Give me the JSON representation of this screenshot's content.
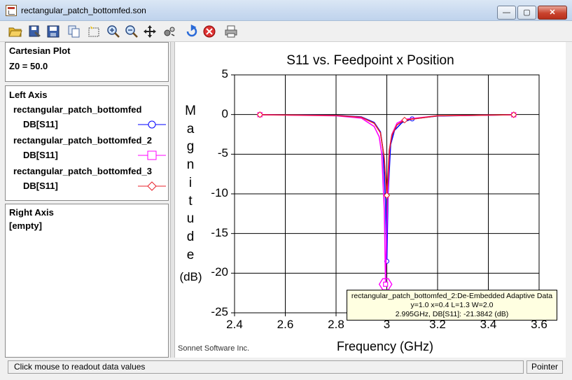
{
  "window": {
    "title": "rectangular_patch_bottomfed.son",
    "min": "—",
    "max": "▢",
    "close": "✕"
  },
  "toolbar": {
    "icons": [
      "open-folder-icon",
      "save-as-icon",
      "save-icon",
      "copy-icon",
      "select-icon",
      "zoom-in-icon",
      "zoom-out-icon",
      "pan-icon",
      "rotate-icon",
      "reload-icon",
      "cancel-icon",
      "print-icon"
    ]
  },
  "panel": {
    "plot_type": "Cartesian Plot",
    "z0": "Z0 = 50.0",
    "left_axis_title": "Left Axis",
    "right_axis_title": "Right Axis",
    "right_axis_value": "[empty]"
  },
  "credit": "Sonnet Software Inc.",
  "tooltip": {
    "line1": "rectangular_patch_bottomfed_2:De-Embedded Adaptive Data",
    "line2": "y=1.0 x=0.4 L=1.3 W=2.0",
    "line3": "2.995GHz, DB[S11]: -21.3842  (dB)"
  },
  "status": {
    "message": "Click mouse to readout data values",
    "mode": "Pointer"
  },
  "chart_data": {
    "type": "line",
    "title": "S11 vs. Feedpoint x Position",
    "xlabel": "Frequency (GHz)",
    "ylabel": "Magnitude",
    "yunit": "(dB)",
    "xlim": [
      2.4,
      3.6
    ],
    "ylim": [
      -25,
      5
    ],
    "xticks": [
      2.4,
      2.6,
      2.8,
      3.0,
      3.2,
      3.4,
      3.6
    ],
    "xtick_labels": [
      "2.4",
      "2.6",
      "2.8",
      "3",
      "3.2",
      "3.4",
      "3.6"
    ],
    "yticks": [
      5,
      0,
      -5,
      -10,
      -15,
      -20,
      -25
    ],
    "ytick_labels": [
      "5",
      "0",
      "-5",
      "-10",
      "-15",
      "-20",
      "-25"
    ],
    "grid": true,
    "series": [
      {
        "name": "rectangular_patch_bottomfed",
        "param": "DB[S11]",
        "color": "#0000ff",
        "marker": "circle",
        "x": [
          2.5,
          2.8,
          2.9,
          2.95,
          2.975,
          2.985,
          2.995,
          3.0,
          3.005,
          3.015,
          3.03,
          3.06,
          3.1,
          3.2,
          3.5
        ],
        "y": [
          -0.02,
          -0.1,
          -0.3,
          -1.0,
          -2.2,
          -4.5,
          -11.0,
          -18.5,
          -10.0,
          -3.8,
          -2.0,
          -1.0,
          -0.55,
          -0.18,
          -0.03
        ],
        "markers_x": [
          2.5,
          3.0,
          3.1,
          3.5
        ],
        "markers_y": [
          -0.02,
          -18.5,
          -0.55,
          -0.03
        ]
      },
      {
        "name": "rectangular_patch_bottomfed_2",
        "param": "DB[S11]",
        "color": "#ff00ff",
        "marker": "square",
        "x": [
          2.5,
          2.8,
          2.9,
          2.95,
          2.97,
          2.98,
          2.99,
          2.995,
          3.0,
          3.01,
          3.02,
          3.04,
          3.07,
          3.2,
          3.5
        ],
        "y": [
          -0.02,
          -0.15,
          -0.45,
          -1.5,
          -2.8,
          -5.0,
          -12.0,
          -21.4,
          -14.0,
          -4.5,
          -2.5,
          -1.1,
          -0.6,
          -0.15,
          -0.03
        ],
        "markers_x": [
          2.5,
          2.995,
          3.5
        ],
        "markers_y": [
          -0.02,
          -21.4,
          -0.03
        ]
      },
      {
        "name": "rectangular_patch_bottomfed_3",
        "param": "DB[S11]",
        "color": "#e8202a",
        "marker": "diamond",
        "x": [
          2.5,
          2.8,
          2.9,
          2.95,
          2.975,
          2.99,
          3.0,
          3.005,
          3.01,
          3.02,
          3.04,
          3.07,
          3.2,
          3.5
        ],
        "y": [
          -0.02,
          -0.12,
          -0.35,
          -1.1,
          -2.3,
          -5.5,
          -10.2,
          -7.5,
          -4.5,
          -2.6,
          -1.3,
          -0.7,
          -0.15,
          -0.03
        ],
        "markers_x": [
          2.5,
          3.0,
          3.07,
          3.5
        ],
        "markers_y": [
          -0.02,
          -10.2,
          -0.7,
          -0.03
        ]
      }
    ]
  }
}
